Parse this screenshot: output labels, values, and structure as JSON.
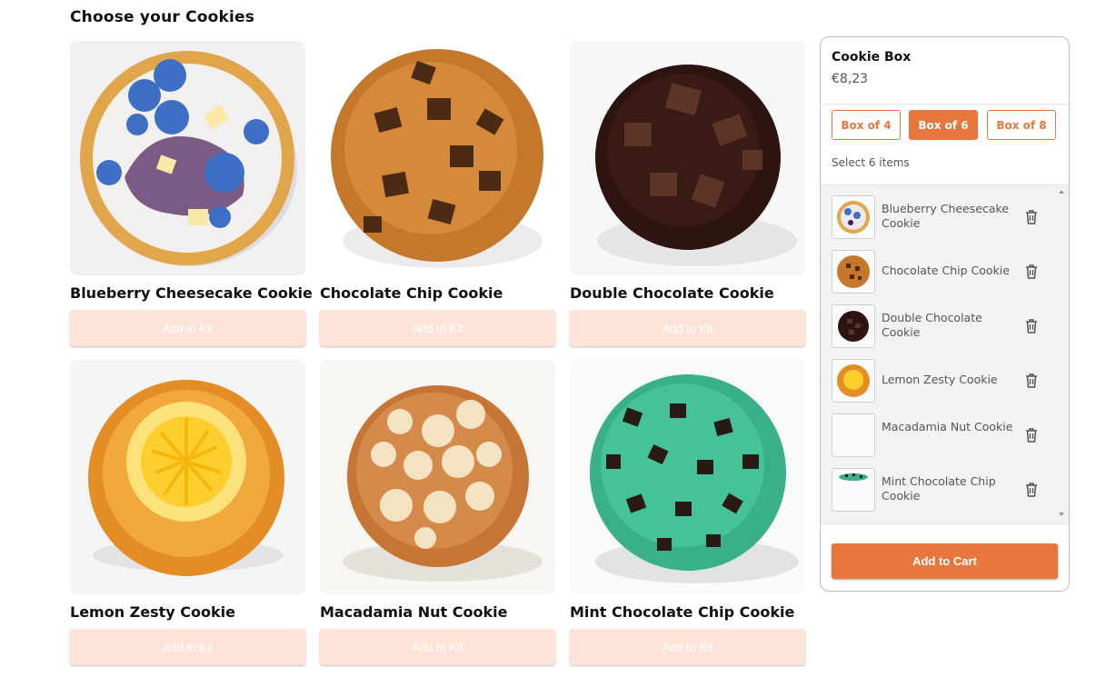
{
  "page": {
    "title": "Choose your Cookies"
  },
  "products": [
    {
      "name": "Blueberry Cheesecake Cookie",
      "button": "Add to Kit",
      "image": "blueberry-cheesecake-cookie-image"
    },
    {
      "name": "Chocolate Chip Cookie",
      "button": "Add to Kit",
      "image": "chocolate-chip-cookie-image"
    },
    {
      "name": "Double Chocolate Cookie",
      "button": "Add to Kit",
      "image": "double-chocolate-cookie-image"
    },
    {
      "name": "Lemon Zesty Cookie",
      "button": "Add to Kit",
      "image": "lemon-zesty-cookie-image"
    },
    {
      "name": "Macadamia Nut Cookie",
      "button": "Add to Kit",
      "image": "macadamia-nut-cookie-image"
    },
    {
      "name": "Mint Chocolate Chip Cookie",
      "button": "Add to Kit",
      "image": "mint-chocolate-chip-cookie-image"
    }
  ],
  "box": {
    "title": "Cookie Box",
    "price": "€8,23",
    "options": [
      {
        "label": "Box of 4",
        "selected": false
      },
      {
        "label": "Box of 6",
        "selected": true
      },
      {
        "label": "Box of 8",
        "selected": false
      }
    ],
    "select_note": "Select 6 items",
    "items": [
      {
        "name": "Blueberry Cheesecake Cookie",
        "icon": "trash-icon"
      },
      {
        "name": "Chocolate Chip Cookie",
        "icon": "trash-icon"
      },
      {
        "name": "Double Chocolate Cookie",
        "icon": "trash-icon"
      },
      {
        "name": "Lemon Zesty Cookie",
        "icon": "trash-icon"
      },
      {
        "name": "Macadamia Nut Cookie",
        "icon": "trash-icon"
      },
      {
        "name": "Mint Chocolate Chip Cookie",
        "icon": "trash-icon"
      }
    ],
    "cart_button": "Add to Cart"
  },
  "colors": {
    "accent": "#e8773e",
    "accent_light": "#fde3d8",
    "panel_list_bg": "#f3f3f3"
  }
}
